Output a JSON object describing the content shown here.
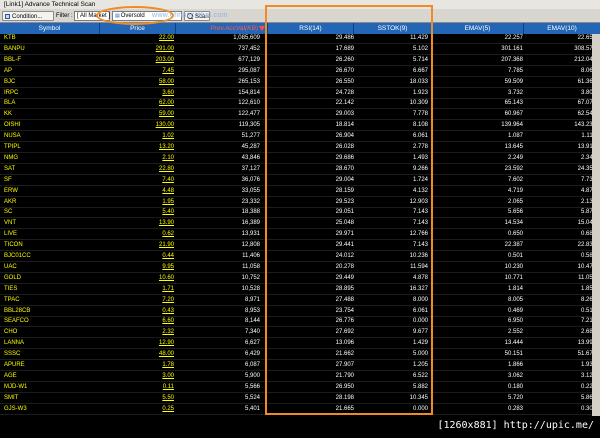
{
  "window": {
    "title": "[Link1] Advance Technical Scan"
  },
  "toolbar": {
    "condition_label": "Condition...",
    "filter_label": "Filter :",
    "market_value": "[ All Market ]",
    "formula_value": "Oversold",
    "scan_label": "Scan"
  },
  "watermark": "www.efinancethai.com",
  "columns": {
    "symbol": "Symbol",
    "price": "Price",
    "prev_acc_val": "Prev.AccVal(KB)",
    "rsi": "RSI(14)",
    "sstok": "SSTOK(9)",
    "emav5": "EMAV(5)",
    "emav10": "EMAV(10)"
  },
  "rows": [
    {
      "symbol": "KTB",
      "price": "22.00",
      "prev_acc_val": "1,085,609",
      "rsi": "29.486",
      "sstok": "11.429",
      "emav5": "22.257",
      "emav10": "22.653"
    },
    {
      "symbol": "BANPU",
      "price": "291.00",
      "prev_acc_val": "737,452",
      "rsi": "17.689",
      "sstok": "5.102",
      "emav5": "301.161",
      "emav10": "308.579"
    },
    {
      "symbol": "BBL-F",
      "price": "203.00",
      "prev_acc_val": "677,129",
      "rsi": "26.260",
      "sstok": "5.714",
      "emav5": "207.368",
      "emav10": "212.043"
    },
    {
      "symbol": "AP",
      "price": "7.45",
      "prev_acc_val": "295,087",
      "rsi": "26.670",
      "sstok": "6.667",
      "emav5": "7.785",
      "emav10": "8.060"
    },
    {
      "symbol": "BJC",
      "price": "58.00",
      "prev_acc_val": "265,153",
      "rsi": "26.550",
      "sstok": "18.033",
      "emav5": "59.509",
      "emav10": "61.368"
    },
    {
      "symbol": "IRPC",
      "price": "3.60",
      "prev_acc_val": "154,814",
      "rsi": "24.728",
      "sstok": "1.923",
      "emav5": "3.732",
      "emav10": "3.809"
    },
    {
      "symbol": "BLA",
      "price": "62.00",
      "prev_acc_val": "122,610",
      "rsi": "22.142",
      "sstok": "10.309",
      "emav5": "65.143",
      "emav10": "67.075"
    },
    {
      "symbol": "KK",
      "price": "59.00",
      "prev_acc_val": "122,477",
      "rsi": "29.003",
      "sstok": "7.778",
      "emav5": "60.967",
      "emav10": "62.544"
    },
    {
      "symbol": "OISHI",
      "price": "130.00",
      "prev_acc_val": "119,305",
      "rsi": "18.814",
      "sstok": "8.108",
      "emav5": "139.964",
      "emav10": "143.234"
    },
    {
      "symbol": "NUSA",
      "price": "1.02",
      "prev_acc_val": "51,277",
      "rsi": "26.904",
      "sstok": "6.061",
      "emav5": "1.087",
      "emav10": "1.117"
    },
    {
      "symbol": "TPIPL",
      "price": "13.20",
      "prev_acc_val": "45,287",
      "rsi": "26.028",
      "sstok": "2.778",
      "emav5": "13.645",
      "emav10": "13.915"
    },
    {
      "symbol": "NMG",
      "price": "2.10",
      "prev_acc_val": "43,846",
      "rsi": "29.686",
      "sstok": "1.493",
      "emav5": "2.249",
      "emav10": "2.342"
    },
    {
      "symbol": "SAT",
      "price": "22.80",
      "prev_acc_val": "37,127",
      "rsi": "28.670",
      "sstok": "9.266",
      "emav5": "23.592",
      "emav10": "24.353"
    },
    {
      "symbol": "SF",
      "price": "7.40",
      "prev_acc_val": "36,076",
      "rsi": "29.004",
      "sstok": "1.724",
      "emav5": "7.602",
      "emav10": "7.736"
    },
    {
      "symbol": "ERW",
      "price": "4.48",
      "prev_acc_val": "33,055",
      "rsi": "28.159",
      "sstok": "4.132",
      "emav5": "4.719",
      "emav10": "4.879"
    },
    {
      "symbol": "AKR",
      "price": "1.95",
      "prev_acc_val": "23,332",
      "rsi": "29.523",
      "sstok": "12.903",
      "emav5": "2.065",
      "emav10": "2.131"
    },
    {
      "symbol": "SC",
      "price": "5.40",
      "prev_acc_val": "18,388",
      "rsi": "29.051",
      "sstok": "7.143",
      "emav5": "5.656",
      "emav10": "5.874"
    },
    {
      "symbol": "VNT",
      "price": "13.90",
      "prev_acc_val": "16,389",
      "rsi": "25.048",
      "sstok": "7.143",
      "emav5": "14.534",
      "emav10": "15.049"
    },
    {
      "symbol": "LIVE",
      "price": "0.62",
      "prev_acc_val": "13,931",
      "rsi": "29.971",
      "sstok": "12.766",
      "emav5": "0.650",
      "emav10": "0.680"
    },
    {
      "symbol": "TICON",
      "price": "21.90",
      "prev_acc_val": "12,808",
      "rsi": "29.441",
      "sstok": "7.143",
      "emav5": "22.387",
      "emav10": "22.834"
    },
    {
      "symbol": "BJC01CC",
      "price": "0.44",
      "prev_acc_val": "11,406",
      "rsi": "24.012",
      "sstok": "10.236",
      "emav5": "0.501",
      "emav10": "0.586"
    },
    {
      "symbol": "UAC",
      "price": "9.95",
      "prev_acc_val": "11,058",
      "rsi": "20.278",
      "sstok": "11.594",
      "emav5": "10.230",
      "emav10": "10.474"
    },
    {
      "symbol": "GOLD",
      "price": "10.60",
      "prev_acc_val": "10,752",
      "rsi": "29.449",
      "sstok": "4.878",
      "emav5": "10.771",
      "emav10": "11.053"
    },
    {
      "symbol": "TIES",
      "price": "1.71",
      "prev_acc_val": "10,528",
      "rsi": "28.895",
      "sstok": "16.327",
      "emav5": "1.814",
      "emav10": "1.852"
    },
    {
      "symbol": "TPAC",
      "price": "7.20",
      "prev_acc_val": "8,971",
      "rsi": "27.488",
      "sstok": "8.000",
      "emav5": "8.005",
      "emav10": "8.263"
    },
    {
      "symbol": "BBL28CB",
      "price": "0.43",
      "prev_acc_val": "8,953",
      "rsi": "23.754",
      "sstok": "6.061",
      "emav5": "0.469",
      "emav10": "0.516"
    },
    {
      "symbol": "SEAFCO",
      "price": "6.60",
      "prev_acc_val": "8,144",
      "rsi": "26.776",
      "sstok": "0.000",
      "emav5": "6.950",
      "emav10": "7.212"
    },
    {
      "symbol": "CHO",
      "price": "2.32",
      "prev_acc_val": "7,340",
      "rsi": "27.692",
      "sstok": "9.677",
      "emav5": "2.552",
      "emav10": "2.684"
    },
    {
      "symbol": "LANNA",
      "price": "12.90",
      "prev_acc_val": "6,627",
      "rsi": "13.096",
      "sstok": "1.429",
      "emav5": "13.444",
      "emav10": "13.995"
    },
    {
      "symbol": "SSSC",
      "price": "48.00",
      "prev_acc_val": "6,429",
      "rsi": "21.662",
      "sstok": "5.000",
      "emav5": "50.151",
      "emav10": "51.677"
    },
    {
      "symbol": "APURE",
      "price": "1.78",
      "prev_acc_val": "6,087",
      "rsi": "27.907",
      "sstok": "1.205",
      "emav5": "1.866",
      "emav10": "1.937"
    },
    {
      "symbol": "AGE",
      "price": "3.00",
      "prev_acc_val": "5,900",
      "rsi": "21.790",
      "sstok": "6.522",
      "emav5": "3.062",
      "emav10": "3.125"
    },
    {
      "symbol": "MJD-W1",
      "price": "0.11",
      "prev_acc_val": "5,566",
      "rsi": "26.950",
      "sstok": "5.882",
      "emav5": "0.180",
      "emav10": "0.229"
    },
    {
      "symbol": "SMIT",
      "price": "5.50",
      "prev_acc_val": "5,524",
      "rsi": "28.198",
      "sstok": "10.345",
      "emav5": "5.720",
      "emav10": "5.866"
    },
    {
      "symbol": "GJS-W3",
      "price": "0.25",
      "prev_acc_val": "5,401",
      "rsi": "21.665",
      "sstok": "0.000",
      "emav5": "0.283",
      "emav10": "0.305"
    }
  ],
  "footer": {
    "text": "[1260x881] http://upic.me/"
  },
  "colors": {
    "header_bg": "#2366b5",
    "highlight": "#f08a24",
    "symbol": "#ffff00",
    "sort_column": "#ff5a5a"
  },
  "icons": [
    "condition-icon",
    "scan-icon",
    "chart-icon",
    "sort-desc-icon"
  ]
}
